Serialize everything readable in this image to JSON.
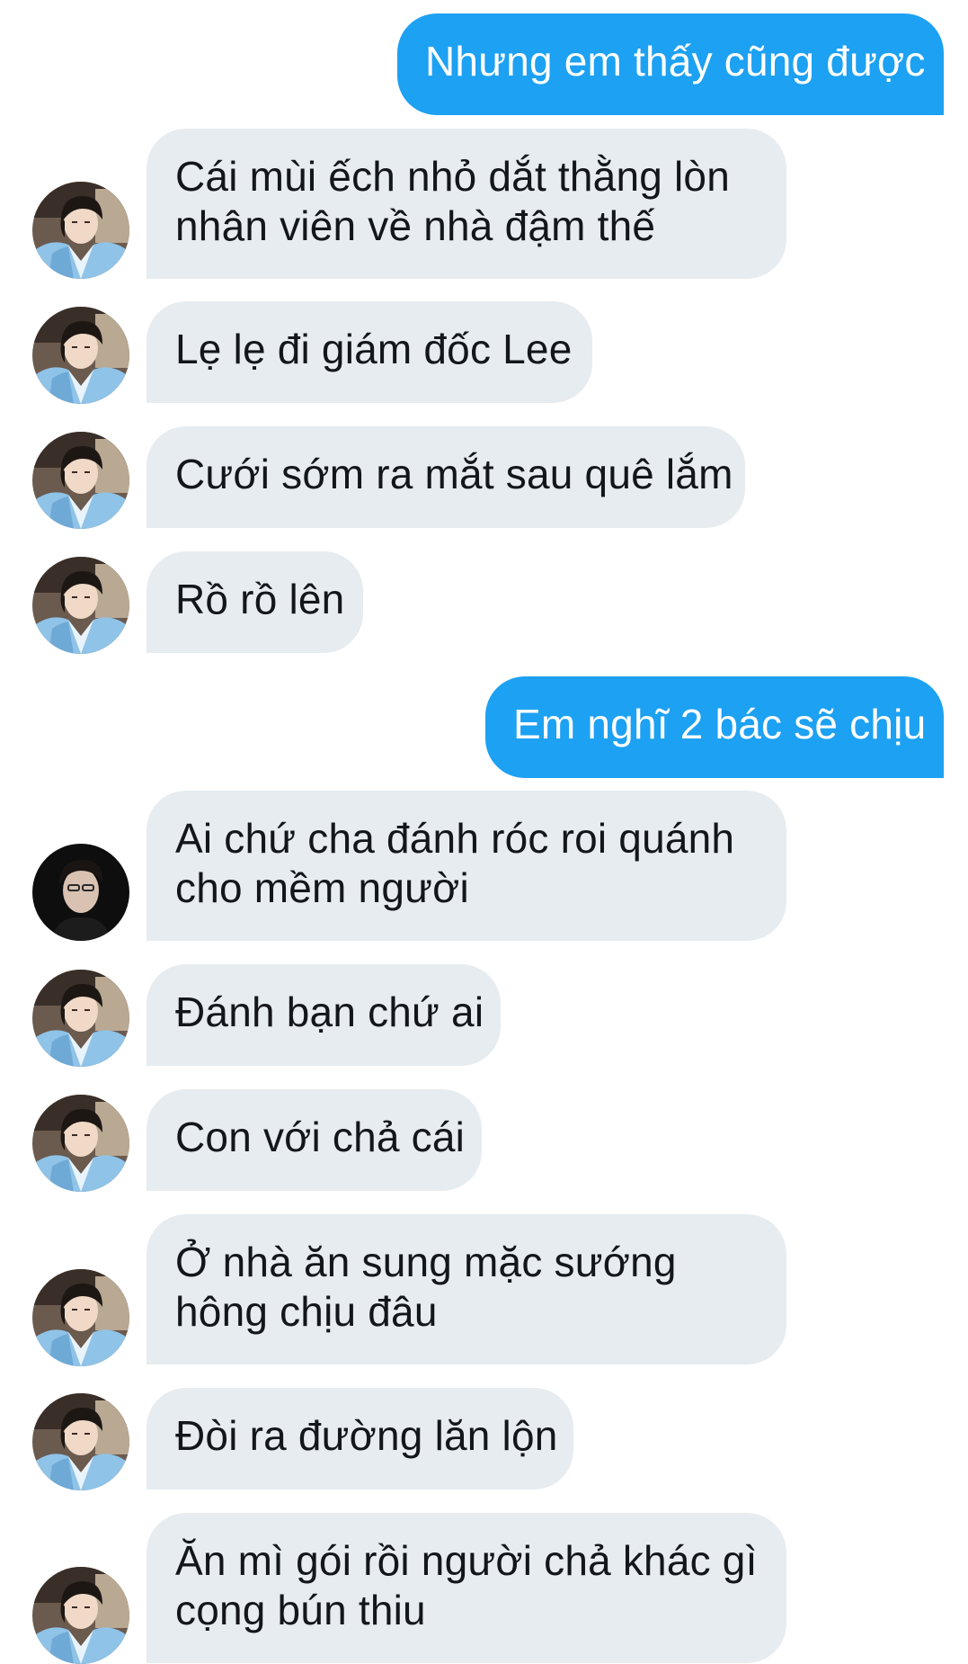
{
  "conversation": {
    "messages": [
      {
        "from": "me",
        "lines": [
          "Nhưng em thấy cũng được"
        ]
      },
      {
        "from": "them",
        "avatar": "hanbok",
        "lines": [
          "Cái mùi ếch nhỏ dắt thằng lòn",
          "nhân viên về nhà đậm thế"
        ]
      },
      {
        "from": "them",
        "avatar": "hanbok",
        "lines": [
          "Lẹ lẹ đi giám đốc Lee"
        ]
      },
      {
        "from": "them",
        "avatar": "hanbok",
        "lines": [
          "Cưới sớm ra mắt sau quê lắm"
        ]
      },
      {
        "from": "them",
        "avatar": "hanbok",
        "lines": [
          "Rồ rồ lên"
        ]
      },
      {
        "from": "me",
        "lines": [
          "Em nghĩ 2 bác sẽ chịu"
        ]
      },
      {
        "from": "them",
        "avatar": "dark-portrait",
        "lines": [
          "Ai chứ cha đánh róc roi quánh",
          "cho mềm người"
        ]
      },
      {
        "from": "them",
        "avatar": "hanbok",
        "lines": [
          "Đánh bạn chứ ai"
        ]
      },
      {
        "from": "them",
        "avatar": "hanbok",
        "lines": [
          "Con với chả cái"
        ]
      },
      {
        "from": "them",
        "avatar": "hanbok",
        "lines": [
          "Ở nhà ăn sung mặc sướng",
          "hông chịu đâu"
        ]
      },
      {
        "from": "them",
        "avatar": "hanbok",
        "lines": [
          "Đòi ra đường lăn lộn"
        ]
      },
      {
        "from": "them",
        "avatar": "hanbok",
        "lines": [
          "Ăn mì gói rồi người chả khác gì",
          "cọng bún thiu"
        ]
      }
    ]
  },
  "colors": {
    "outgoing_bubble": "#1da1f2",
    "incoming_bubble": "#e6ecf0",
    "outgoing_text": "#ffffff",
    "incoming_text": "#14171a"
  }
}
